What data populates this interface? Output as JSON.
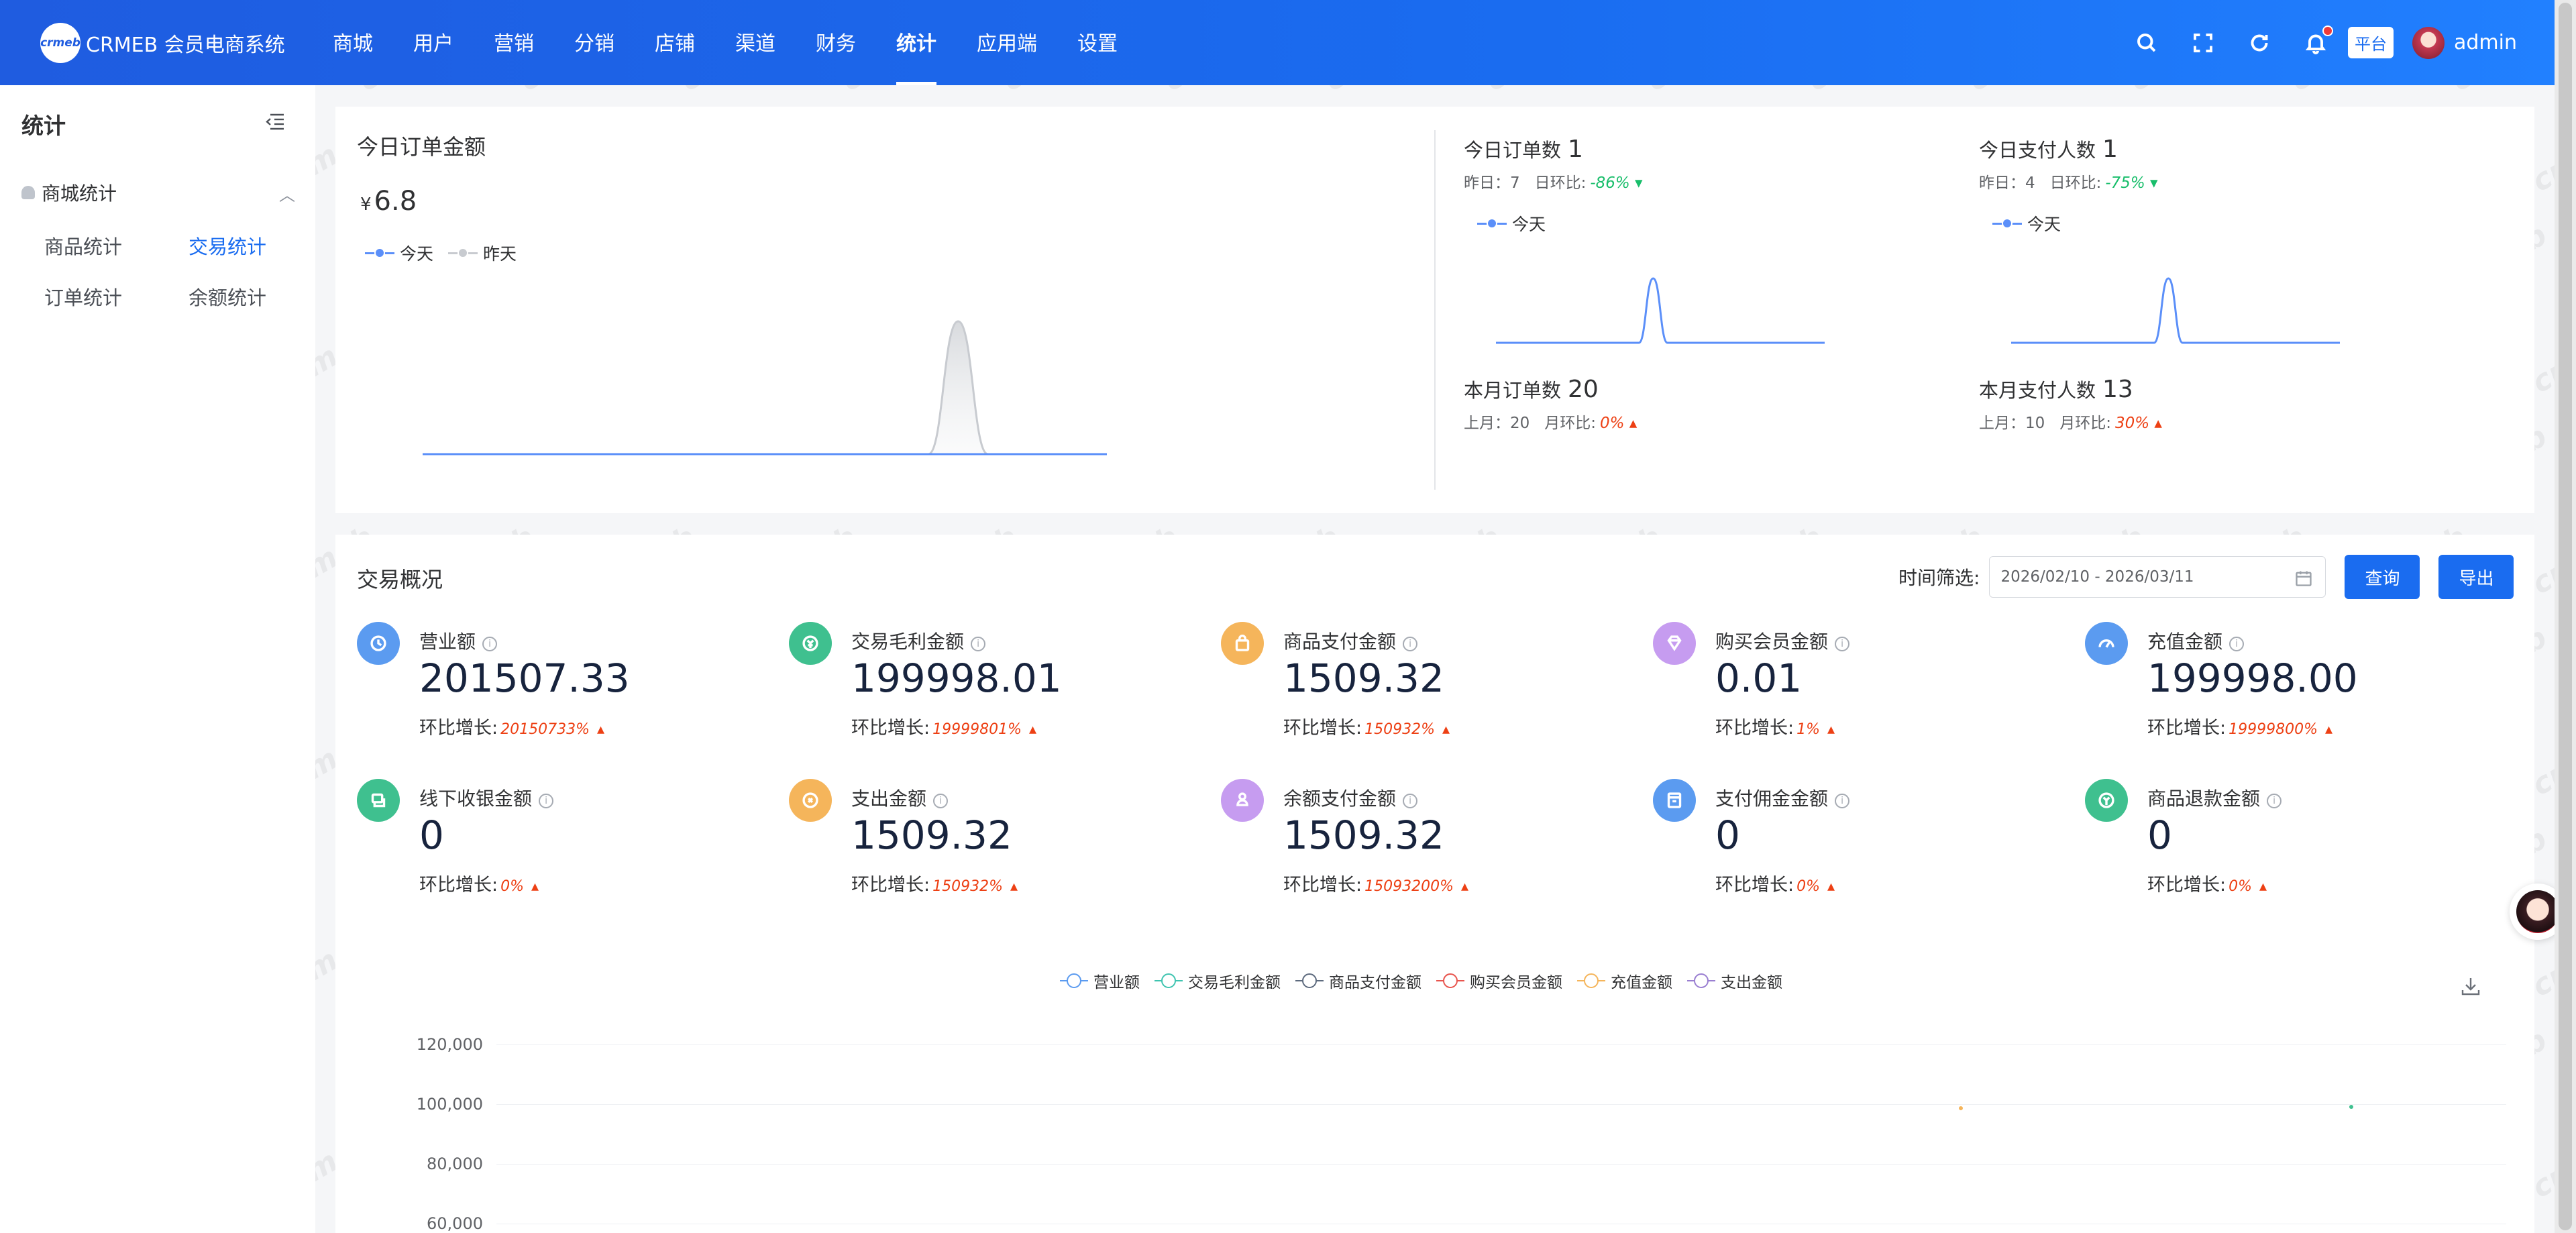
{
  "header": {
    "logo_badge": "crmeb",
    "app_title": "CRMEB 会员电商系统",
    "nav": [
      "商城",
      "用户",
      "营销",
      "分销",
      "店铺",
      "渠道",
      "财务",
      "统计",
      "应用端",
      "设置"
    ],
    "active_nav": "统计",
    "icons": [
      "search-icon",
      "fullscreen-icon",
      "refresh-icon",
      "bell-icon"
    ],
    "platform_label": "平台",
    "user_name": "admin"
  },
  "sidebar": {
    "title": "统计",
    "group_label": "商城统计",
    "items": [
      "商品统计",
      "交易统计",
      "订单统计",
      "余额统计"
    ],
    "active_item": "交易统计"
  },
  "today_card": {
    "title": "今日订单金额",
    "currency": "¥",
    "amount": "6.8",
    "legend_today": "今天",
    "legend_yesterday": "昨天",
    "colors": {
      "today": "#5b8ff9",
      "yesterday": "#c8cbd0"
    }
  },
  "stats": {
    "today_orders": {
      "label": "今日订单数",
      "value": "1",
      "sub_label": "昨日：7",
      "ratio_label": "日环比:",
      "ratio": "-86%",
      "trend": "down",
      "legend": "今天"
    },
    "today_payers": {
      "label": "今日支付人数",
      "value": "1",
      "sub_label": "昨日：4",
      "ratio_label": "日环比:",
      "ratio": "-75%",
      "trend": "down",
      "legend": "今天"
    },
    "month_orders": {
      "label": "本月订单数",
      "value": "20",
      "sub_label": "上月：20",
      "ratio_label": "月环比:",
      "ratio": "0%",
      "trend": "up"
    },
    "month_payers": {
      "label": "本月支付人数",
      "value": "13",
      "sub_label": "上月：10",
      "ratio_label": "月环比:",
      "ratio": "30%",
      "trend": "up"
    }
  },
  "overview": {
    "title": "交易概况",
    "filter_label": "时间筛选:",
    "date_range": "2026/02/10 - 2026/03/11",
    "query_button": "查询",
    "export_button": "导出",
    "growth_label": "环比增长:",
    "metrics": [
      {
        "name": "营业额",
        "value": "201507.33",
        "growth": "20150733%",
        "color": "#5b9bf0",
        "icon": "clock-icon"
      },
      {
        "name": "交易毛利金额",
        "value": "199998.01",
        "growth": "19999801%",
        "color": "#3fc08f",
        "icon": "money-icon"
      },
      {
        "name": "商品支付金额",
        "value": "1509.32",
        "growth": "150932%",
        "color": "#f5b55b",
        "icon": "bag-icon"
      },
      {
        "name": "购买会员金额",
        "value": "0.01",
        "growth": "1%",
        "color": "#c69cf0",
        "icon": "diamond-icon"
      },
      {
        "name": "充值金额",
        "value": "199998.00",
        "growth": "19999800%",
        "color": "#5b9bf0",
        "icon": "gauge-icon"
      },
      {
        "name": "线下收银金额",
        "value": "0",
        "growth": "0%",
        "color": "#3fc08f",
        "icon": "cashier-icon"
      },
      {
        "name": "支出金额",
        "value": "1509.32",
        "growth": "150932%",
        "color": "#f5b55b",
        "icon": "expense-icon"
      },
      {
        "name": "余额支付金额",
        "value": "1509.32",
        "growth": "15093200%",
        "color": "#c69cf0",
        "icon": "wallet-icon"
      },
      {
        "name": "支付佣金金额",
        "value": "0",
        "growth": "0%",
        "color": "#5b9bf0",
        "icon": "commission-icon"
      },
      {
        "name": "商品退款金额",
        "value": "0",
        "growth": "0%",
        "color": "#3fc08f",
        "icon": "refund-icon"
      }
    ]
  },
  "chart_data": [
    {
      "type": "area",
      "legend": [
        "今天",
        "昨天"
      ],
      "series": [
        {
          "name": "今天",
          "color": "#5b8ff9",
          "values": [
            0,
            0,
            0,
            0,
            0,
            0,
            0,
            0,
            0,
            0,
            0,
            0,
            0,
            0,
            0,
            0,
            0,
            0,
            0,
            0,
            0,
            0,
            0,
            0
          ]
        },
        {
          "name": "昨天",
          "color": "#c8cbd0",
          "values": [
            0,
            0,
            0,
            0,
            0,
            0,
            0,
            0,
            0,
            0,
            0,
            0,
            0,
            0,
            0,
            0,
            0,
            0,
            1,
            0,
            0,
            0,
            0,
            0
          ]
        }
      ]
    },
    {
      "type": "line",
      "legend": [
        "今天"
      ],
      "series": [
        {
          "name": "今天",
          "color": "#5b8ff9",
          "values": [
            0,
            0,
            0,
            0,
            0,
            0,
            0,
            0,
            0,
            0,
            0,
            1,
            0,
            0,
            0,
            0,
            0,
            0,
            0,
            0,
            0,
            0,
            0,
            0
          ]
        }
      ]
    },
    {
      "type": "line",
      "legend": [
        "今天"
      ],
      "series": [
        {
          "name": "今天",
          "color": "#5b8ff9",
          "values": [
            0,
            0,
            0,
            0,
            0,
            0,
            0,
            0,
            0,
            0,
            0,
            1,
            0,
            0,
            0,
            0,
            0,
            0,
            0,
            0,
            0,
            0,
            0,
            0
          ]
        }
      ]
    },
    {
      "type": "line",
      "legend": [
        "营业额",
        "交易毛利金额",
        "商品支付金额",
        "购买会员金额",
        "充值金额",
        "支出金额"
      ],
      "legend_colors": [
        "#5b9bf0",
        "#3fc4b0",
        "#5d6a7e",
        "#e8554e",
        "#f5b55b",
        "#9a7fd1"
      ],
      "y_ticks": [
        "120,000",
        "100,000",
        "80,000",
        "60,000"
      ],
      "ylim": [
        0,
        120000
      ]
    }
  ]
}
